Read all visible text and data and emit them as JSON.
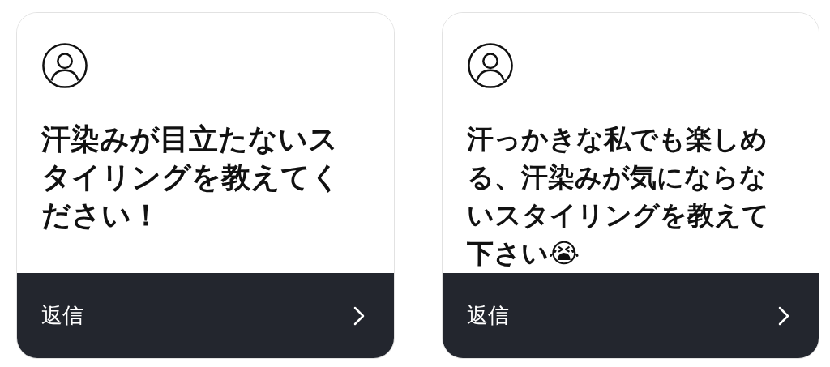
{
  "cards": [
    {
      "question": "汗染みが目立たないスタイリングを教えてください！",
      "reply": "返信"
    },
    {
      "question": "汗っかきな私でも楽しめる、汗染みが気にならないスタイリングを教えて下さい😭",
      "reply": "返信"
    }
  ]
}
